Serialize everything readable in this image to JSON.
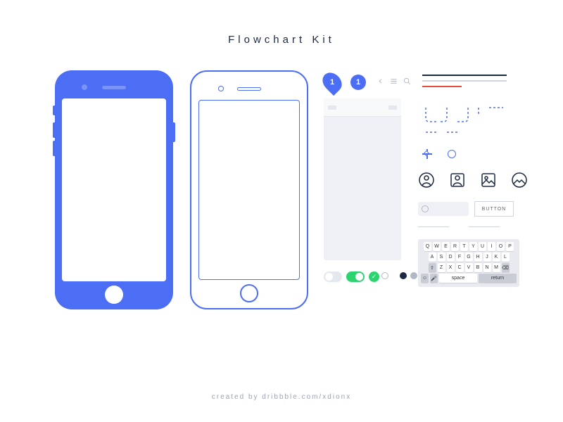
{
  "title": "Flowchart Kit",
  "footer": "created by dribbble.com/xdionx",
  "pin_label": "1",
  "badge_label": "1",
  "button_label": "BUTTON",
  "keyboard": {
    "row1": [
      "Q",
      "W",
      "E",
      "R",
      "T",
      "Y",
      "U",
      "I",
      "O",
      "P"
    ],
    "row2": [
      "A",
      "S",
      "D",
      "F",
      "G",
      "H",
      "J",
      "K",
      "L"
    ],
    "row3_shift": "⇧",
    "row3": [
      "Z",
      "X",
      "C",
      "V",
      "B",
      "N",
      "M"
    ],
    "row3_del": "⌫",
    "row4": {
      "emoji": "☺",
      "mic": "🎤",
      "space": "space",
      "return": "return"
    }
  }
}
